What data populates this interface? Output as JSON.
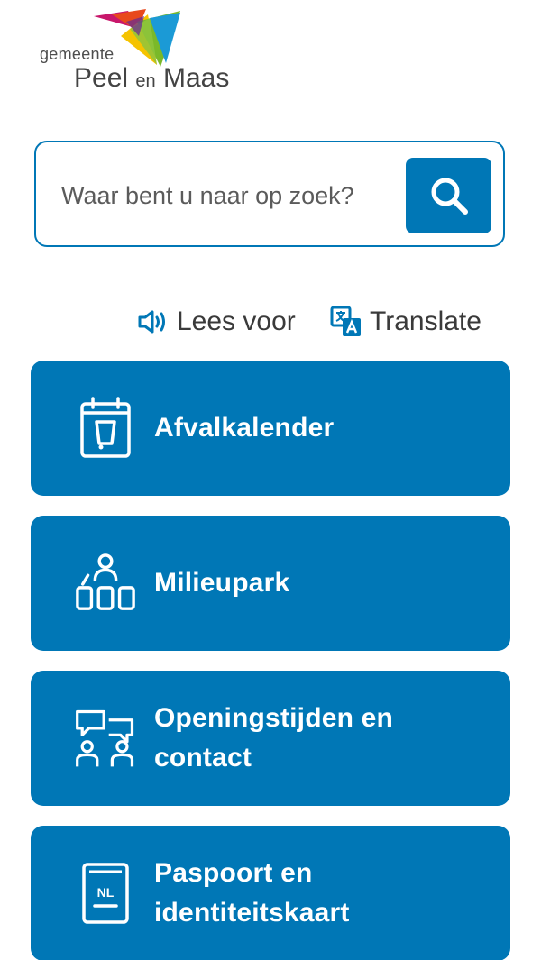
{
  "brand": {
    "prefix": "gemeente",
    "name_part1": "Peel",
    "name_part2": "en",
    "name_part3": "Maas",
    "logo_colors": [
      "#c8176b",
      "#e8491d",
      "#f5c300",
      "#7ab929",
      "#1b9ad6",
      "#6a2c91"
    ]
  },
  "search": {
    "placeholder": "Waar bent u naar op zoek?",
    "value": "",
    "icon": "search-icon"
  },
  "utilities": {
    "read_aloud": {
      "label": "Lees voor",
      "icon": "speaker-icon"
    },
    "translate": {
      "label": "Translate",
      "icon": "translate-icon"
    }
  },
  "tiles": [
    {
      "label": "Afvalkalender",
      "icon": "waste-calendar-icon"
    },
    {
      "label": "Milieupark",
      "icon": "recycling-park-icon"
    },
    {
      "label": "Openingstijden en contact",
      "icon": "contact-chat-icon"
    },
    {
      "label": "Paspoort en identiteitskaart",
      "icon": "passport-nl-icon"
    }
  ],
  "colors": {
    "accent": "#0077b6",
    "text": "#3a3a3a",
    "tile_text": "#ffffff"
  }
}
